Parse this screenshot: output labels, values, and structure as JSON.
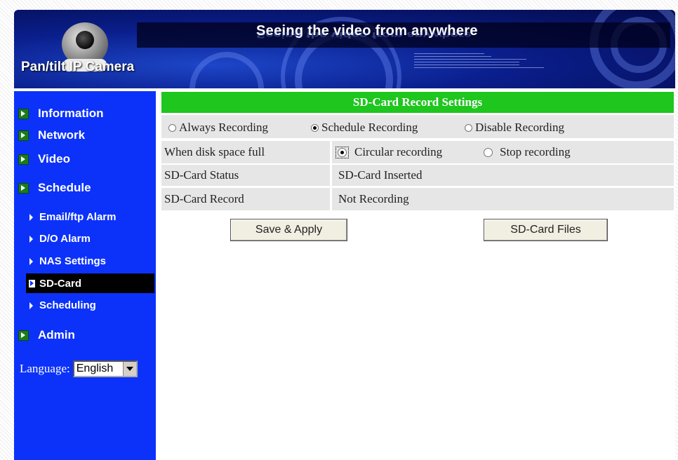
{
  "banner": {
    "title": "Seeing the video from anywhere",
    "brand": "Pan/tilt IP Camera",
    "camera_icon": "camera-icon"
  },
  "sidebar": {
    "items": [
      {
        "label": "Information"
      },
      {
        "label": "Network"
      },
      {
        "label": "Video"
      },
      {
        "label": "Schedule"
      }
    ],
    "sub_items": [
      {
        "label": "Email/ftp Alarm"
      },
      {
        "label": "D/O Alarm"
      },
      {
        "label": "NAS Settings"
      },
      {
        "label": "SD-Card"
      },
      {
        "label": "Scheduling"
      }
    ],
    "admin_label": "Admin",
    "language_label": "Language:",
    "language_value": "English"
  },
  "main": {
    "header": "SD-Card Record Settings",
    "mode_options": {
      "always": "Always Recording",
      "schedule": "Schedule Recording",
      "disable": "Disable Recording",
      "selected": "schedule"
    },
    "disk_full": {
      "label": "When disk space full",
      "circular": "Circular recording",
      "stop": "Stop recording",
      "selected": "circular"
    },
    "status": {
      "label": "SD-Card Status",
      "value": "SD-Card Inserted"
    },
    "record": {
      "label": "SD-Card Record",
      "value": "Not Recording"
    },
    "buttons": {
      "save": "Save & Apply",
      "files": "SD-Card Files"
    }
  },
  "colors": {
    "sidebar": "#0c32fa",
    "header": "#1ec61e",
    "row": "#e6e6e6"
  }
}
